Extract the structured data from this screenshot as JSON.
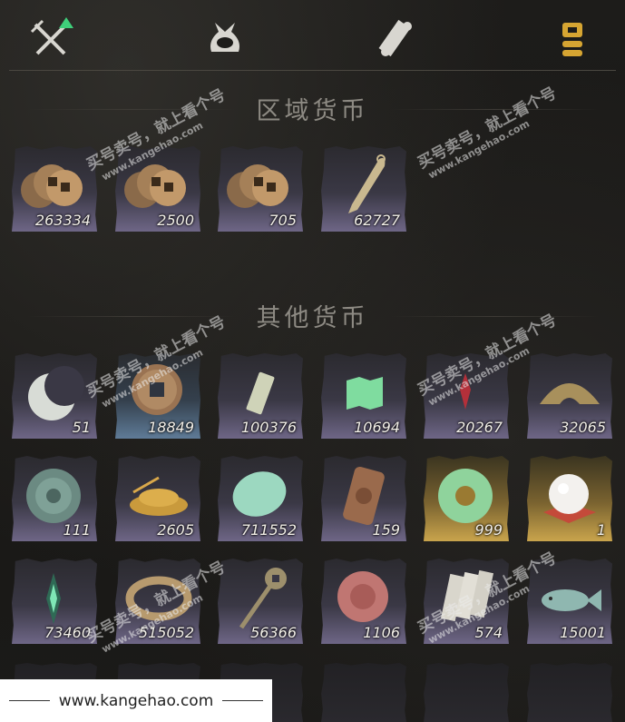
{
  "tabs": [
    {
      "name": "weapons-tab",
      "icon": "crossed-swords-icon"
    },
    {
      "name": "bundle-tab",
      "icon": "bundle-icon"
    },
    {
      "name": "scroll-tab",
      "icon": "scroll-icon"
    },
    {
      "name": "currency-tab",
      "icon": "coin-stack-icon",
      "active": true
    }
  ],
  "sections": {
    "regional_title": "区域货币",
    "other_title": "其他货币"
  },
  "regional_items": [
    {
      "name": "copper-coins-1",
      "count": "263334",
      "rarity": "purple",
      "icon": "coin-stack-icon"
    },
    {
      "name": "copper-coins-2",
      "count": "2500",
      "rarity": "purple",
      "icon": "coin-stack-icon"
    },
    {
      "name": "copper-coins-3",
      "count": "705",
      "rarity": "purple",
      "icon": "coin-stack-icon"
    },
    {
      "name": "throwing-knife",
      "count": "62727",
      "rarity": "purple",
      "icon": "blade-icon"
    }
  ],
  "other_items": [
    {
      "name": "jade-crescent",
      "count": "51",
      "rarity": "purple",
      "icon": "crescent-icon"
    },
    {
      "name": "ancient-coin",
      "count": "18849",
      "rarity": "blue",
      "icon": "square-hole-coin-icon"
    },
    {
      "name": "green-tablet",
      "count": "100376",
      "rarity": "purple",
      "icon": "tablet-icon"
    },
    {
      "name": "green-map",
      "count": "10694",
      "rarity": "purple",
      "icon": "map-icon"
    },
    {
      "name": "red-token",
      "count": "20267",
      "rarity": "purple",
      "icon": "red-token-icon"
    },
    {
      "name": "half-coin",
      "count": "32065",
      "rarity": "purple",
      "icon": "half-coin-icon"
    },
    {
      "name": "jade-disc",
      "count": "111",
      "rarity": "purple",
      "icon": "carved-disc-icon"
    },
    {
      "name": "grain-pile",
      "count": "2605",
      "rarity": "purple",
      "icon": "grain-icon"
    },
    {
      "name": "jade-stone",
      "count": "711552",
      "rarity": "purple",
      "icon": "jade-stone-icon"
    },
    {
      "name": "bronze-plaque",
      "count": "159",
      "rarity": "purple",
      "icon": "plaque-icon"
    },
    {
      "name": "jade-bi",
      "count": "999",
      "rarity": "gold",
      "icon": "jade-ring-icon"
    },
    {
      "name": "pearl",
      "count": "1",
      "rarity": "gold",
      "icon": "pearl-icon"
    },
    {
      "name": "green-spirit",
      "count": "73460",
      "rarity": "purple",
      "icon": "spirit-icon"
    },
    {
      "name": "coin-string",
      "count": "515052",
      "rarity": "purple",
      "icon": "coin-string-icon"
    },
    {
      "name": "key-coin",
      "count": "56366",
      "rarity": "purple",
      "icon": "key-coin-icon"
    },
    {
      "name": "red-disc",
      "count": "1106",
      "rarity": "purple",
      "icon": "red-disc-icon"
    },
    {
      "name": "silver-notes",
      "count": "574",
      "rarity": "purple",
      "icon": "notes-icon"
    },
    {
      "name": "jade-fish",
      "count": "15001",
      "rarity": "purple",
      "icon": "fish-icon"
    }
  ],
  "watermark": {
    "text_a": "买号卖号，就上看个号",
    "text_b": "www.kangehao.com",
    "text_c": "看个号"
  },
  "footer": {
    "url": "www.kangehao.com"
  }
}
